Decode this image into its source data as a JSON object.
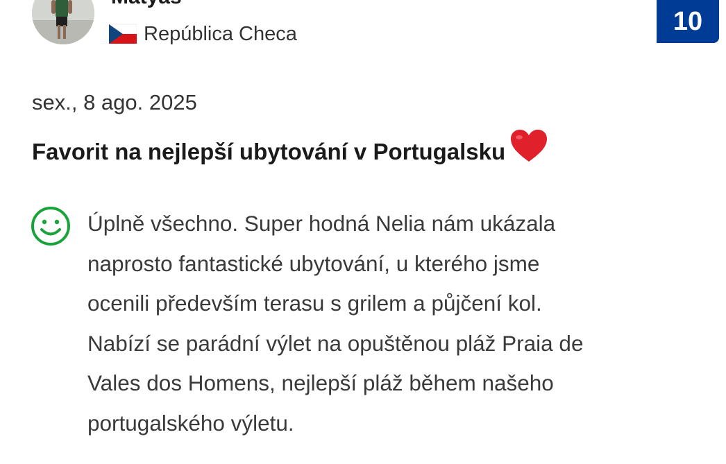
{
  "reviewer": {
    "name": "Matyáš",
    "country": "República Checa",
    "flag_icon": "czech-flag-icon",
    "score": "10",
    "score_color": "#003b95"
  },
  "review": {
    "date": "sex., 8 ago. 2025",
    "title": "Favorit na nejlepší ubytování v Portugalsku",
    "title_emoji": "heart-icon",
    "positive_icon": "smiley-face-icon",
    "positive_icon_color": "#1aa33a",
    "positive_lines": [
      "Úplně všechno. Super hodná Nelia nám ukázala",
      "naprosto fantastické ubytování, u kterého jsme",
      "ocenili především terasu s grilem a půjčení kol.",
      "Nabízí se parádní výlet na opuštěnou pláž Praia de",
      "Vales dos Homens, nejlepší pláž během našeho",
      "portugalského výletu."
    ]
  }
}
